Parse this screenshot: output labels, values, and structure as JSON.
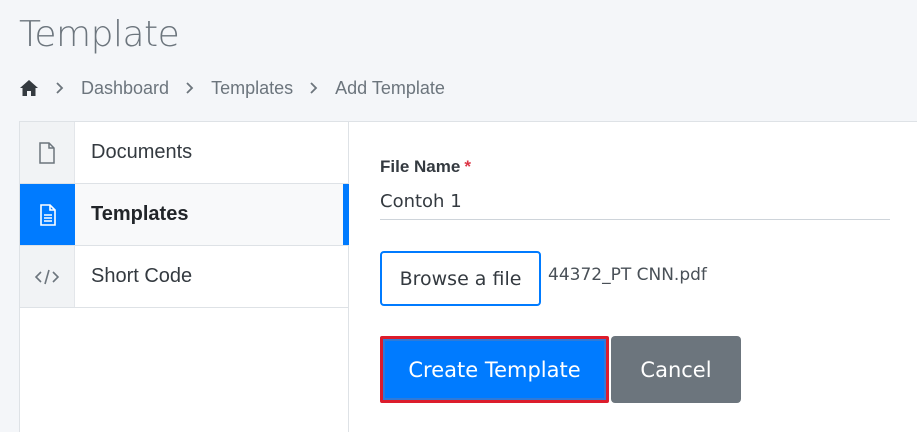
{
  "header": {
    "title": "Template"
  },
  "breadcrumb": {
    "items": [
      "Dashboard",
      "Templates",
      "Add Template"
    ]
  },
  "sidebar": {
    "items": [
      {
        "label": "Documents",
        "icon": "file-icon"
      },
      {
        "label": "Templates",
        "icon": "file-text-icon",
        "active": true
      },
      {
        "label": "Short Code",
        "icon": "code-icon"
      }
    ]
  },
  "form": {
    "file_name_label": "File Name",
    "required_mark": "*",
    "file_name_value": "Contoh 1",
    "browse_label": "Browse a file",
    "selected_file": "44372_PT CNN.pdf",
    "create_label": "Create Template",
    "cancel_label": "Cancel"
  },
  "colors": {
    "primary": "#007bff",
    "secondary": "#6c757d",
    "highlight_border": "#dc1c2c"
  }
}
